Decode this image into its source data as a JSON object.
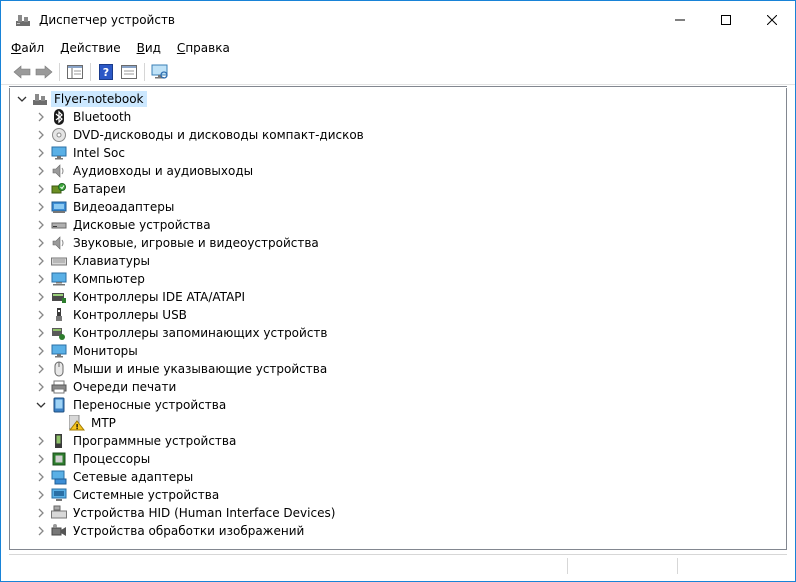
{
  "window": {
    "title": "Диспетчер устройств",
    "minimize_label": "—",
    "maximize_label": "☐",
    "close_label": "✕"
  },
  "menu": [
    {
      "label_u": "Ф",
      "label_rest": "айл"
    },
    {
      "label_u": "Д",
      "label_rest": "ействие"
    },
    {
      "label_u": "В",
      "label_rest": "ид"
    },
    {
      "label_u": "С",
      "label_rest": "правка"
    }
  ],
  "tree": {
    "root": "Flyer-notebook",
    "items": [
      {
        "label": "Bluetooth",
        "icon": "bluetooth-icon"
      },
      {
        "label": "DVD-дисководы и дисководы компакт-дисков",
        "icon": "dvd-icon"
      },
      {
        "label": "Intel Soc",
        "icon": "monitor-icon"
      },
      {
        "label": "Аудиовходы и аудиовыходы",
        "icon": "speaker-icon"
      },
      {
        "label": "Батареи",
        "icon": "battery-icon"
      },
      {
        "label": "Видеоадаптеры",
        "icon": "display-adapter-icon"
      },
      {
        "label": "Дисковые устройства",
        "icon": "disk-icon"
      },
      {
        "label": "Звуковые, игровые и видеоустройства",
        "icon": "speaker-icon"
      },
      {
        "label": "Клавиатуры",
        "icon": "keyboard-icon"
      },
      {
        "label": "Компьютер",
        "icon": "computer-icon"
      },
      {
        "label": "Контроллеры IDE ATA/ATAPI",
        "icon": "ide-icon"
      },
      {
        "label": "Контроллеры USB",
        "icon": "usb-icon"
      },
      {
        "label": "Контроллеры запоминающих устройств",
        "icon": "storage-icon"
      },
      {
        "label": "Мониторы",
        "icon": "monitor-icon"
      },
      {
        "label": "Мыши и иные указывающие устройства",
        "icon": "mouse-icon"
      },
      {
        "label": "Очереди печати",
        "icon": "printer-icon"
      },
      {
        "label": "Переносные устройства",
        "icon": "portable-device-icon",
        "expanded": true
      },
      {
        "label": "MTP",
        "icon": "warning-icon",
        "child": true
      },
      {
        "label": "Программные устройства",
        "icon": "software-device-icon"
      },
      {
        "label": "Процессоры",
        "icon": "processor-icon"
      },
      {
        "label": "Сетевые адаптеры",
        "icon": "network-icon"
      },
      {
        "label": "Системные устройства",
        "icon": "system-device-icon"
      },
      {
        "label": "Устройства HID (Human Interface Devices)",
        "icon": "hid-icon"
      },
      {
        "label": "Устройства обработки изображений",
        "icon": "camera-icon"
      }
    ]
  }
}
